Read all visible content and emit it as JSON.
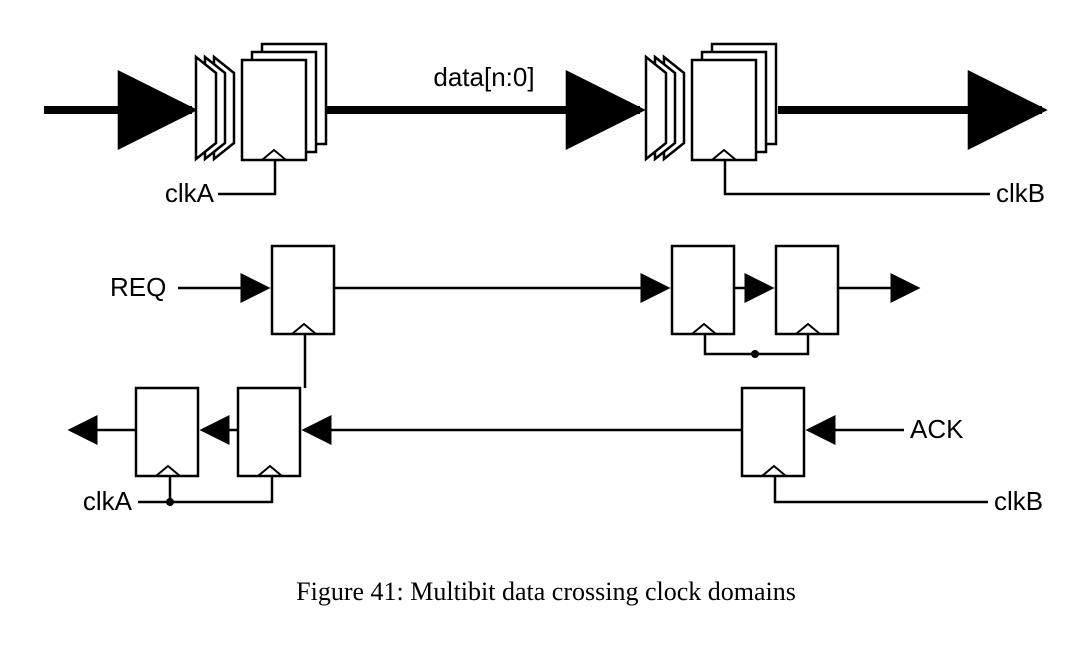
{
  "labels": {
    "data_bus": "data[n:0]",
    "clkA_top": "clkA",
    "clkB_top": "clkB",
    "req": "REQ",
    "ack": "ACK",
    "clkA_bot": "clkA",
    "clkB_bot": "clkB"
  },
  "caption": "Figure 41: Multibit data crossing clock domains"
}
